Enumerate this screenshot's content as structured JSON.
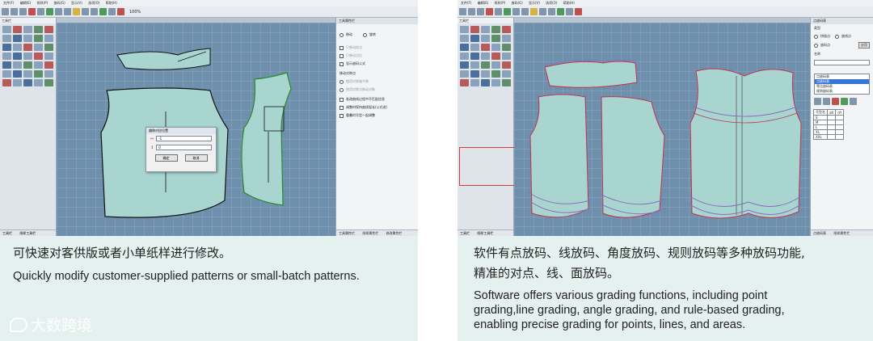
{
  "left": {
    "menu": [
      "文件(F)",
      "编辑(E)",
      "纸样(P)",
      "放码(G)",
      "显示(V)",
      "选项(O)",
      "帮助(H)"
    ],
    "zoom": "100%",
    "tool_panel_title": "工具栏",
    "right_panel_title": "工具属性栏",
    "radio_options": [
      "移动",
      "旋转"
    ],
    "grayed_options": [
      "只移动样点",
      "只移动点位",
      "显示放码公式"
    ],
    "section_label": "移动对称点",
    "section_grayed": [
      "使用对称轴平移",
      "使用对称点移动对象"
    ],
    "checkbox_options": [
      "若改曲线过程中不匹配信息",
      "调整时保持曲线弧长(公式进)",
      "重叠时号型一起调整"
    ],
    "bottom_tabs": [
      "工具栏",
      "纸样工具栏"
    ],
    "right_bottom_tabs": [
      "工具属性栏",
      "纸样属性栏",
      "修改属性栏",
      "参照纸样",
      "快速编辑"
    ],
    "dialog": {
      "title": "偏移对应位置",
      "field1": "-1",
      "field2": "0",
      "ok": "确定",
      "cancel": "取消"
    },
    "caption_zh": "可快速对客供版或者小单纸样进行修改。",
    "caption_en": "Quickly modify customer-supplied patterns or small-batch patterns."
  },
  "right": {
    "menu": [
      "文件(F)",
      "编辑(E)",
      "纸样(P)",
      "放码(G)",
      "显示(V)",
      "选项(O)",
      "帮助(H)"
    ],
    "tool_panel_title": "工具栏",
    "right_panel_title": "点放码表",
    "panel_group": "类型",
    "panel_options": [
      "拼接点",
      "曲线点",
      "放码点"
    ],
    "panel_apply": "应用",
    "panel_name_label": "名称",
    "dropdown_value": "点放码表",
    "dropdown_items": [
      "点放码表",
      "等比放码表",
      "规则放码表"
    ],
    "size_table_header": [
      "号型名",
      "dX",
      "dY"
    ],
    "size_rows": [
      "S",
      "M",
      "L",
      "XL",
      "XXL"
    ],
    "bottom_tabs": [
      "工具栏",
      "纸样工具栏"
    ],
    "right_bottom_tabs": [
      "点放码表",
      "纸样属性栏",
      "修改属性栏"
    ],
    "caption_zh_line1": "软件有点放码、线放码、角度放码、规则放码等多种放码功能,",
    "caption_zh_line2": "精准的对点、线、面放码。",
    "caption_en_line1": "Software offers various grading functions, including point",
    "caption_en_line2": "grading,line grading, angle grading, and rule-based grading,",
    "caption_en_line3": "enabling precise grading for points, lines, and areas."
  },
  "watermark": "大数跨境",
  "colors": {
    "card_bg": "#e4f1ef",
    "canvas_blue": "#6e90ad",
    "piece_fill": "#a9d5d0",
    "grade_red": "#c0334b",
    "grade_purple": "#8a6fbf",
    "highlight_red": "#d43a3a"
  }
}
